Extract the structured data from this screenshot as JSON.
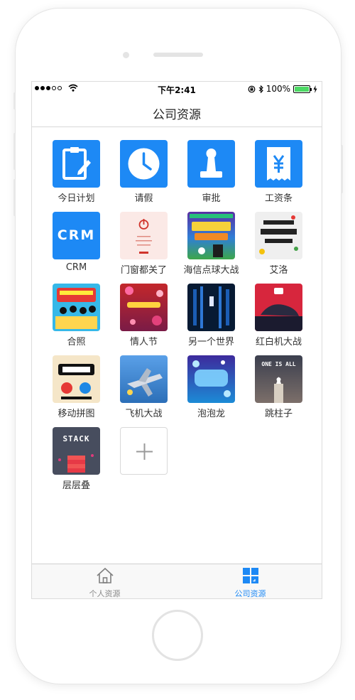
{
  "status_bar": {
    "time": "下午2:41",
    "battery": "100%",
    "battery_level": 1.0,
    "signal_bars_filled": 3,
    "signal_bars_total": 5
  },
  "nav": {
    "title": "公司资源"
  },
  "apps": [
    {
      "label": "今日计划",
      "icon": "clipboard-icon"
    },
    {
      "label": "请假",
      "icon": "clock-icon"
    },
    {
      "label": "审批",
      "icon": "stamp-icon"
    },
    {
      "label": "工资条",
      "icon": "yen-receipt-icon"
    },
    {
      "label": "CRM",
      "icon": "crm-text-icon",
      "tile_text": "CRM"
    },
    {
      "label": "门窗都关了",
      "icon": "power-thumbnail"
    },
    {
      "label": "海信点球大战",
      "icon": "soccer-game-thumbnail"
    },
    {
      "label": "艾洛",
      "icon": "elloworld-thumbnail"
    },
    {
      "label": "合照",
      "icon": "group-photo-thumbnail"
    },
    {
      "label": "情人节",
      "icon": "valentine-thumbnail"
    },
    {
      "label": "另一个世界",
      "icon": "dark-world-thumbnail"
    },
    {
      "label": "红白机大战",
      "icon": "red-sneaker-thumbnail"
    },
    {
      "label": "移动拼图",
      "icon": "puzzle-thumbnail"
    },
    {
      "label": "飞机大战",
      "icon": "airplane-game-thumbnail"
    },
    {
      "label": "泡泡龙",
      "icon": "bubble-dragon-thumbnail"
    },
    {
      "label": "跳柱子",
      "icon": "one-is-all-thumbnail",
      "tile_text": "ONE IS ALL"
    },
    {
      "label": "层层叠",
      "icon": "stack-game-thumbnail",
      "tile_text": "STACK"
    }
  ],
  "add_button": {
    "icon": "plus-icon"
  },
  "tabbar": {
    "items": [
      {
        "label": "个人资源",
        "icon": "home-icon",
        "active": false
      },
      {
        "label": "公司资源",
        "icon": "grid-icon",
        "active": true
      }
    ]
  },
  "colors": {
    "accent": "#1d89f5",
    "battery_green": "#4cd964"
  }
}
